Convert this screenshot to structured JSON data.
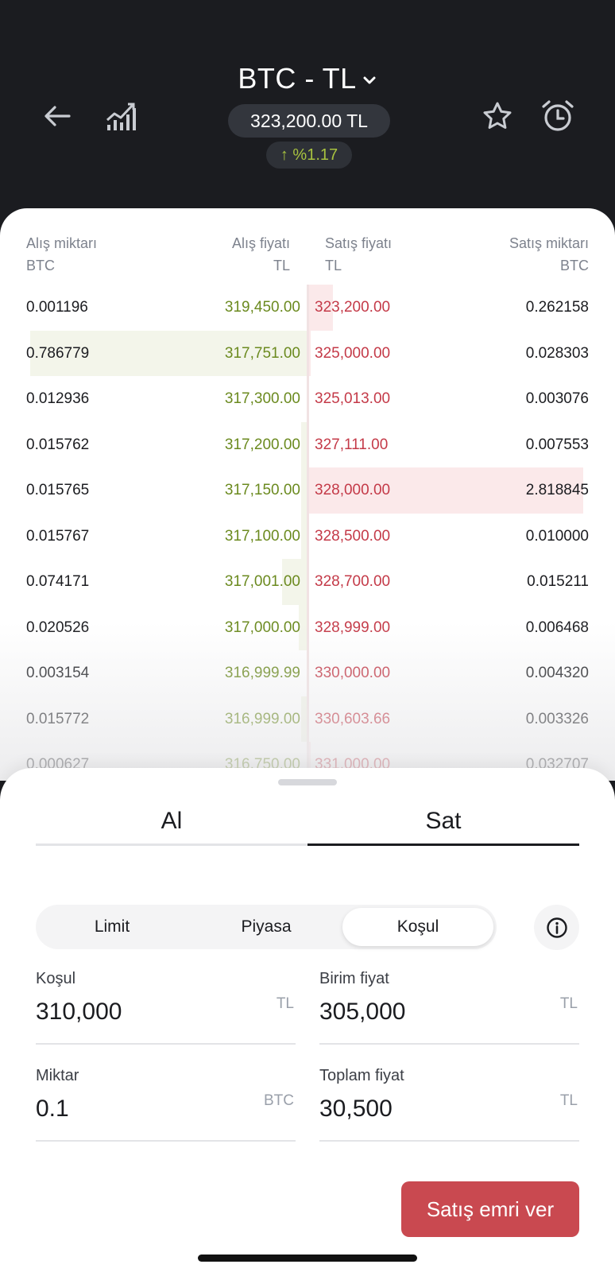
{
  "header": {
    "pair": "BTC - TL",
    "price": "323,200.00 TL",
    "change": "↑ %1.17",
    "icons": [
      "back-arrow-icon",
      "chart-icon",
      "star-icon",
      "alarm-icon"
    ]
  },
  "book": {
    "headers": {
      "bid_qty": "Alış miktarı",
      "bid_qty_unit": "BTC",
      "bid_price": "Alış fiyatı",
      "bid_price_unit": "TL",
      "ask_price": "Satış fiyatı",
      "ask_price_unit": "TL",
      "ask_qty": "Satış miktarı",
      "ask_qty_unit": "BTC"
    },
    "rows": [
      {
        "bq": "0.001196",
        "bp": "319,450.00",
        "ap": "323,200.00",
        "aq": "0.262158",
        "bid_depth": 0.0,
        "ask_depth": 0.09
      },
      {
        "bq": "0.786779",
        "bp": "317,751.00",
        "ap": "325,000.00",
        "aq": "0.028303",
        "bid_depth": 1.0,
        "ask_depth": 0.01
      },
      {
        "bq": "0.012936",
        "bp": "317,300.00",
        "ap": "325,013.00",
        "aq": "0.003076",
        "bid_depth": 0.0,
        "ask_depth": 0.0
      },
      {
        "bq": "0.015762",
        "bp": "317,200.00",
        "ap": "327,111.00",
        "aq": "0.007553",
        "bid_depth": 0.02,
        "ask_depth": 0.0
      },
      {
        "bq": "0.015765",
        "bp": "317,150.00",
        "ap": "328,000.00",
        "aq": "2.818845",
        "bid_depth": 0.02,
        "ask_depth": 1.0
      },
      {
        "bq": "0.015767",
        "bp": "317,100.00",
        "ap": "328,500.00",
        "aq": "0.010000",
        "bid_depth": 0.02,
        "ask_depth": 0.0
      },
      {
        "bq": "0.074171",
        "bp": "317,001.00",
        "ap": "328,700.00",
        "aq": "0.015211",
        "bid_depth": 0.09,
        "ask_depth": 0.0
      },
      {
        "bq": "0.020526",
        "bp": "317,000.00",
        "ap": "328,999.00",
        "aq": "0.006468",
        "bid_depth": 0.03,
        "ask_depth": 0.0
      },
      {
        "bq": "0.003154",
        "bp": "316,999.99",
        "ap": "330,000.00",
        "aq": "0.004320",
        "bid_depth": 0.0,
        "ask_depth": 0.0
      },
      {
        "bq": "0.015772",
        "bp": "316,999.00",
        "ap": "330,603.66",
        "aq": "0.003326",
        "bid_depth": 0.02,
        "ask_depth": 0.0
      },
      {
        "bq": "0.000627",
        "bp": "316,750.00",
        "ap": "331,000.00",
        "aq": "0.032707",
        "bid_depth": 0.0,
        "ask_depth": 0.01
      }
    ]
  },
  "tabs": {
    "buy": "Al",
    "sell": "Sat"
  },
  "order_types": [
    "Limit",
    "Piyasa",
    "Koşul"
  ],
  "form": {
    "condition": {
      "label": "Koşul",
      "value": "310,000",
      "unit": "TL"
    },
    "unit_price": {
      "label": "Birim fiyat",
      "value": "305,000",
      "unit": "TL"
    },
    "amount": {
      "label": "Miktar",
      "value": "0.1",
      "unit": "BTC"
    },
    "total": {
      "label": "Toplam fiyat",
      "value": "30,500",
      "unit": "TL"
    }
  },
  "submit_label": "Satış emri ver",
  "colors": {
    "bid": "#6b8a1f",
    "ask": "#c43a48",
    "submit": "#c94950",
    "header_bg": "#1b1c20"
  }
}
